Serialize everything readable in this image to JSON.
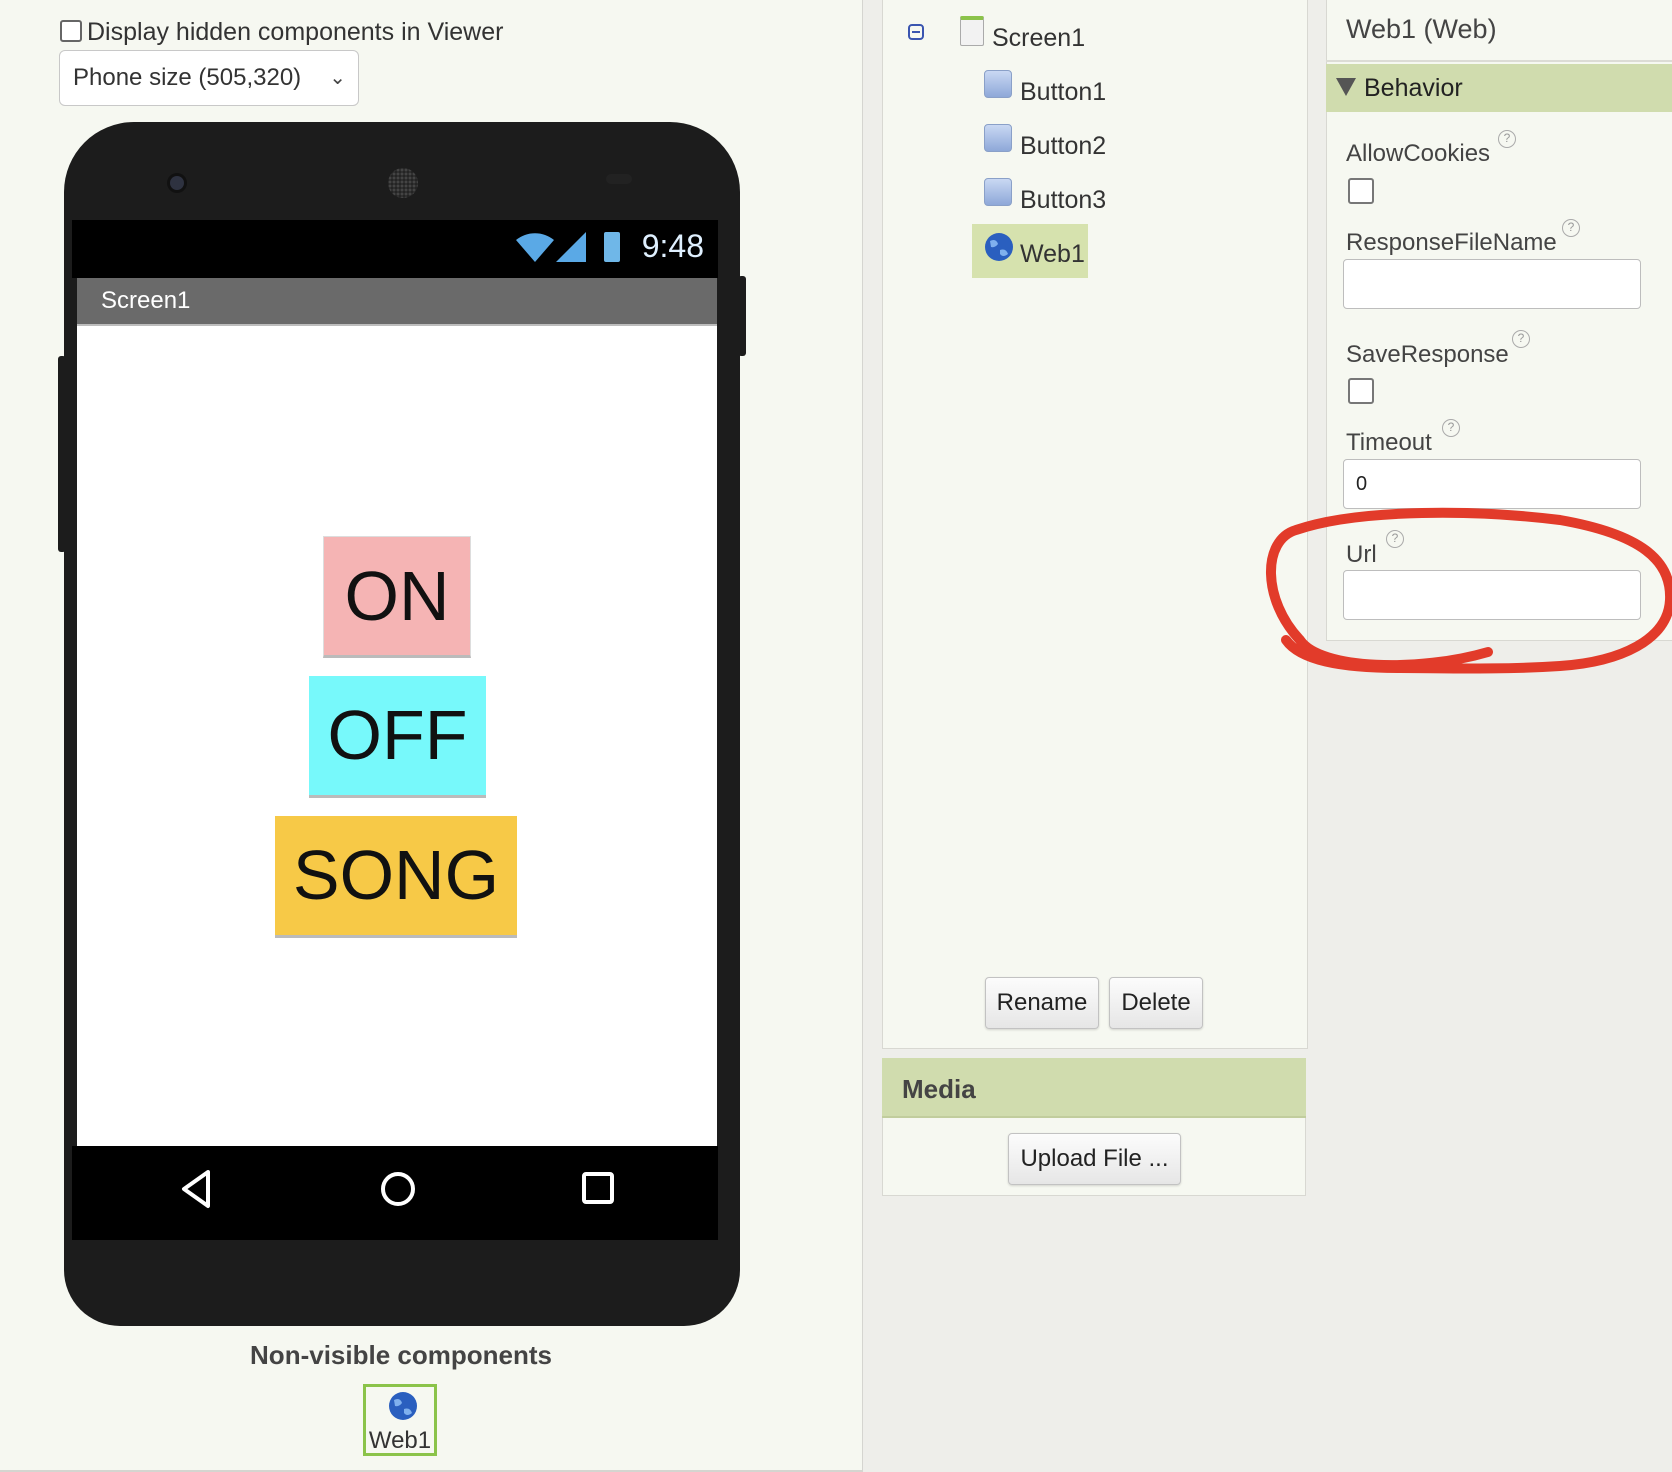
{
  "viewer": {
    "hidden_components_label": "Display hidden components in Viewer",
    "phone_size": "Phone size (505,320)",
    "status_time": "9:48",
    "screen_title": "Screen1",
    "buttons": [
      {
        "label": "ON",
        "color": "#f5b4b4"
      },
      {
        "label": "OFF",
        "color": "#77f9fb"
      },
      {
        "label": "SONG",
        "color": "#f7c947"
      }
    ],
    "non_visible_label": "Non-visible components",
    "non_visible_items": [
      {
        "label": "Web1",
        "icon": "globe-icon"
      }
    ]
  },
  "components": {
    "tree": [
      {
        "label": "Screen1",
        "icon": "screen-icon"
      },
      {
        "label": "Button1",
        "icon": "button-icon"
      },
      {
        "label": "Button2",
        "icon": "button-icon"
      },
      {
        "label": "Button3",
        "icon": "button-icon"
      },
      {
        "label": "Web1",
        "icon": "globe-icon",
        "selected": true
      }
    ],
    "rename_label": "Rename",
    "delete_label": "Delete"
  },
  "media": {
    "title": "Media",
    "upload_label": "Upload File ..."
  },
  "properties": {
    "title": "Web1 (Web)",
    "section": "Behavior",
    "allow_cookies_label": "AllowCookies",
    "allow_cookies": false,
    "response_file_label": "ResponseFileName",
    "response_file_value": "",
    "save_response_label": "SaveResponse",
    "save_response": false,
    "timeout_label": "Timeout",
    "timeout_value": "0",
    "url_label": "Url",
    "url_value": ""
  },
  "colors": {
    "accent_green": "#d0dcae",
    "selection_border": "#8bc34a",
    "annotation_red": "#e23b2a"
  }
}
